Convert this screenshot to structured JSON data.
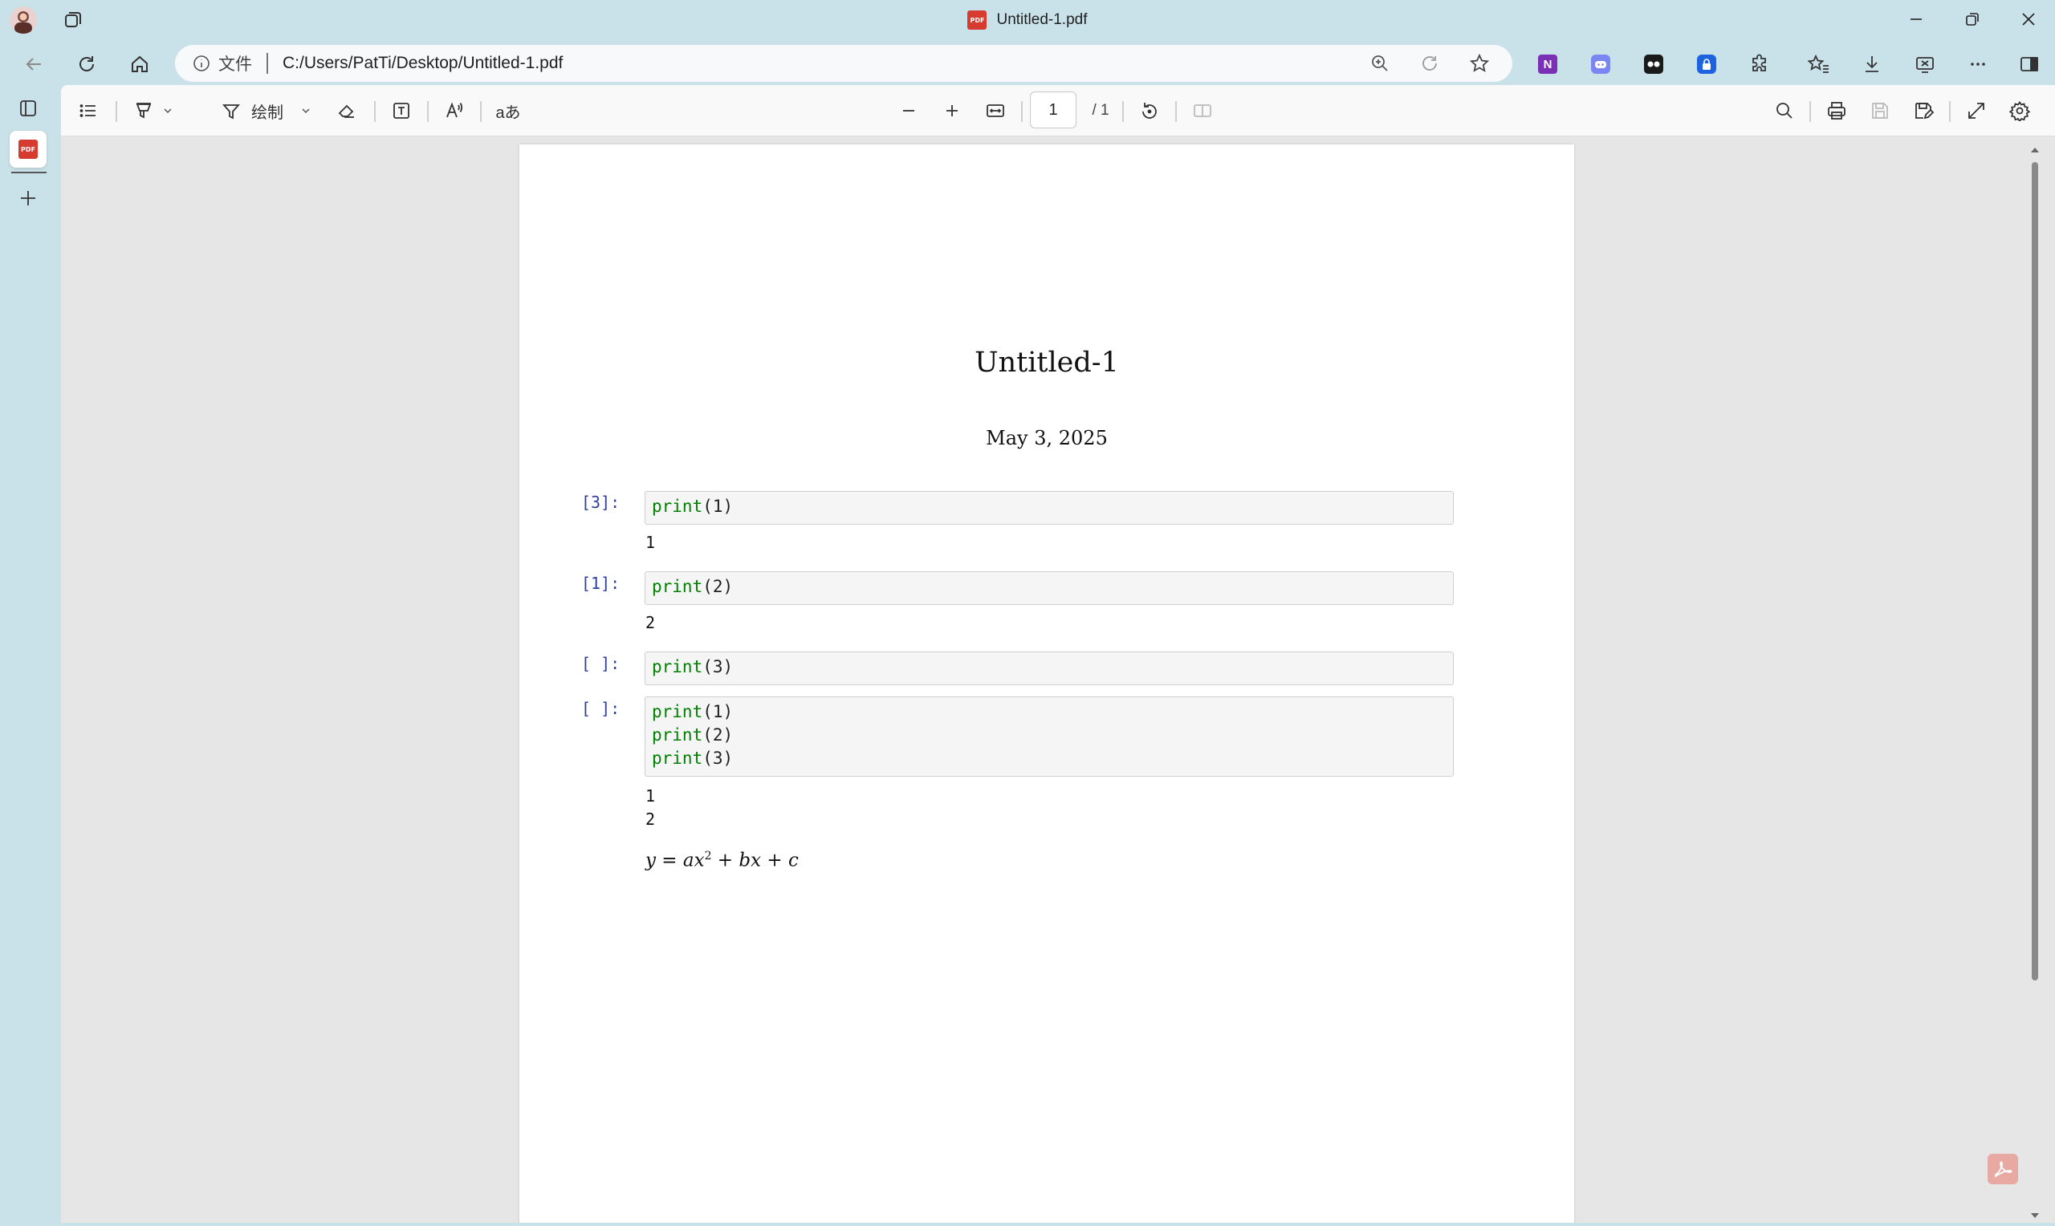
{
  "window": {
    "title": "Untitled-1.pdf",
    "pdf_badge": "PDF"
  },
  "nav": {
    "address_prefix": "文件",
    "url": "C:/Users/PatTi/Desktop/Untitled-1.pdf"
  },
  "extensions": {
    "onenote": "N"
  },
  "toolbar": {
    "draw_label": "绘制",
    "translate_label": "aあ",
    "page_current": "1",
    "page_total": "/ 1"
  },
  "document": {
    "title": "Untitled-1",
    "date": "May 3, 2025",
    "cells": [
      {
        "prompt": "[3]:",
        "code": [
          {
            "fn": "print",
            "arg": "1"
          }
        ]
      },
      {
        "prompt": "[1]:",
        "code": [
          {
            "fn": "print",
            "arg": "2"
          }
        ]
      },
      {
        "prompt": "[ ]:",
        "code": [
          {
            "fn": "print",
            "arg": "3"
          }
        ]
      },
      {
        "prompt": "[ ]:",
        "code": [
          {
            "fn": "print",
            "arg": "1"
          },
          {
            "fn": "print",
            "arg": "2"
          },
          {
            "fn": "print",
            "arg": "3"
          }
        ]
      }
    ],
    "outputs": [
      "1",
      "2",
      "1",
      "2"
    ],
    "equation": {
      "lhs": "y = ax",
      "exponent": "2",
      "rhs": " + bx + c"
    }
  },
  "colors": {
    "chrome_bg": "#c9e1e8",
    "viewer_bg": "#e6e6e6",
    "keyword": "#008000",
    "prompt": "#303f9f"
  }
}
